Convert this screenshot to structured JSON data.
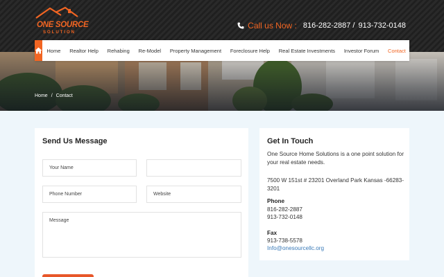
{
  "brand": {
    "name_line1": "ONE SOURCE",
    "name_line2": "SOLUTION",
    "accent": "#f26522"
  },
  "header": {
    "call_label": "Call us Now :",
    "phone1": "816-282-2887 /",
    "phone2": "913-732-0148"
  },
  "nav": {
    "items": [
      {
        "label": "Home"
      },
      {
        "label": "Realtor Help"
      },
      {
        "label": "Rehabing"
      },
      {
        "label": "Re-Model"
      },
      {
        "label": "Property Management"
      },
      {
        "label": "Foreclosure Help"
      },
      {
        "label": "Real Estate Investments"
      },
      {
        "label": "Investor Forum"
      },
      {
        "label": "Contact",
        "active": true
      }
    ]
  },
  "breadcrumb": {
    "home": "Home",
    "sep": "/",
    "current": "Contact"
  },
  "form": {
    "title": "Send Us Message",
    "name_placeholder": "Your Name",
    "email_placeholder": "",
    "phone_placeholder": "Phone Number",
    "website_placeholder": "Website",
    "message_placeholder": "Message"
  },
  "contact": {
    "title": "Get In Touch",
    "intro": "One Source Home Solutions is a one point solution for your real estate needs.",
    "address": "7500 W 151st # 23201 Overland Park Kansas -66283-3201",
    "phone_label": "Phone",
    "phone1": "816-282-2887",
    "phone2": "913-732-0148",
    "fax_label": "Fax",
    "fax": "913-738-5578",
    "email": "Info@onesourcellc.org"
  }
}
